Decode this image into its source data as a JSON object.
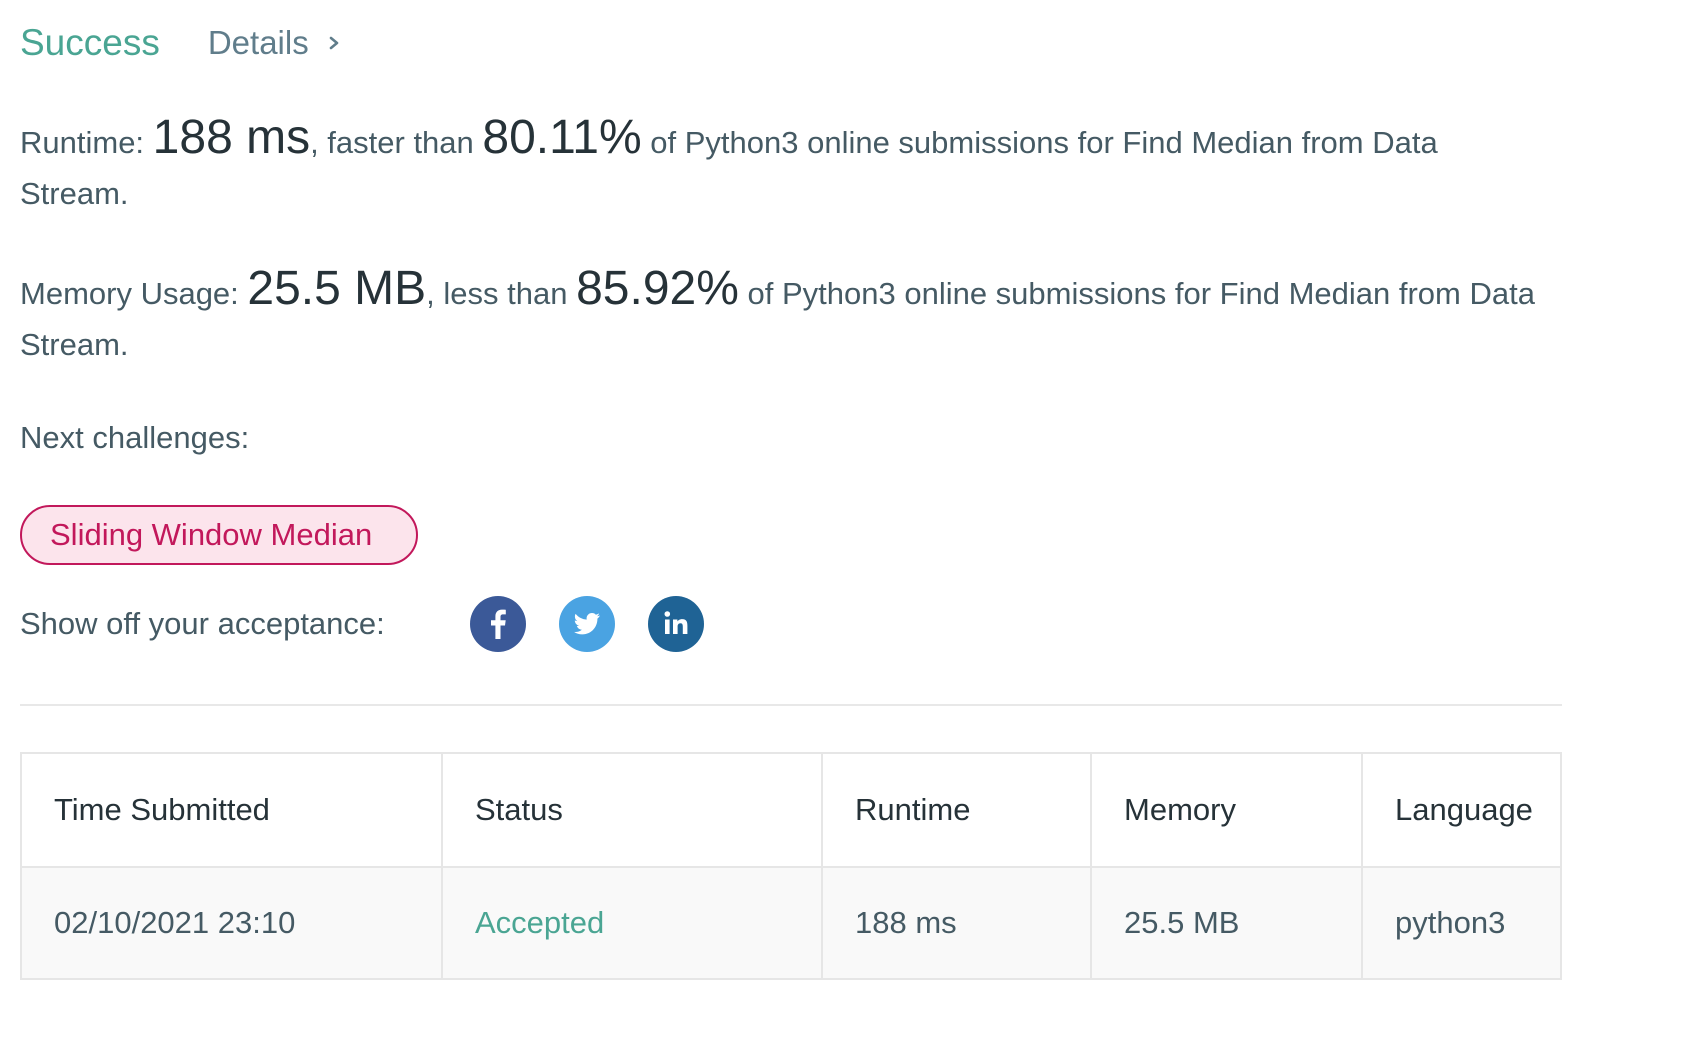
{
  "header": {
    "status": "Success",
    "details_label": "Details"
  },
  "runtime_stat": {
    "label": "Runtime: ",
    "value": "188 ms",
    "mid_text": ", faster than ",
    "percent": "80.11%",
    "tail_text": " of Python3 online submissions for Find Median from Data Stream."
  },
  "memory_stat": {
    "label": "Memory Usage: ",
    "value": "25.5 MB",
    "mid_text": ", less than ",
    "percent": "85.92%",
    "tail_text": " of Python3 online submissions for Find Median from Data Stream."
  },
  "next_challenges": {
    "title": "Next challenges:",
    "items": [
      "Sliding Window Median"
    ]
  },
  "share": {
    "label": "Show off your acceptance:",
    "icons": [
      "facebook-icon",
      "twitter-icon",
      "linkedin-icon"
    ]
  },
  "submissions_table": {
    "headers": [
      "Time Submitted",
      "Status",
      "Runtime",
      "Memory",
      "Language"
    ],
    "rows": [
      [
        "02/10/2021 23:10",
        "Accepted",
        "188 ms",
        "25.5 MB",
        "python3"
      ]
    ]
  },
  "colors": {
    "success": "#4aa593",
    "chip_border": "#c2185b",
    "chip_bg": "#fce4ec",
    "facebook": "#3b5998",
    "twitter": "#4aa3e2",
    "linkedin": "#1f6395"
  }
}
